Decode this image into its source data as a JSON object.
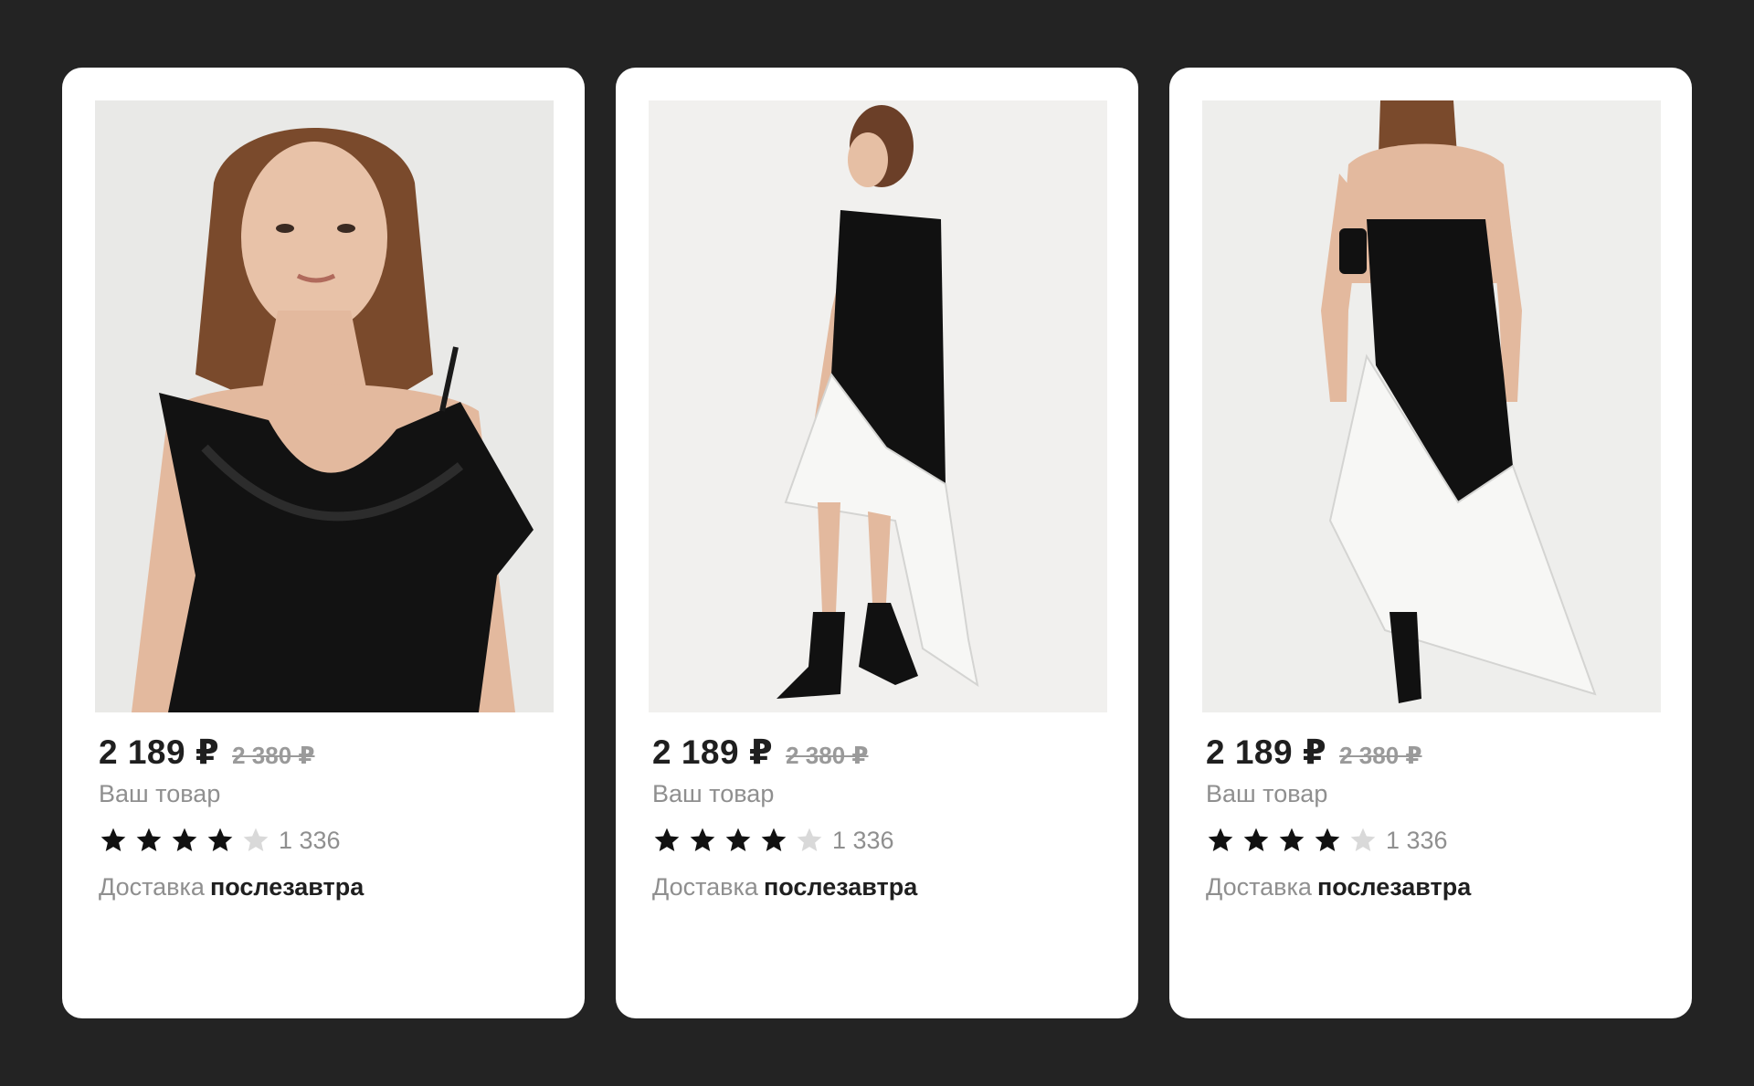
{
  "products": [
    {
      "price": "2 189 ₽",
      "old_price": "2 380 ₽",
      "title": "Ваш товар",
      "rating": 4,
      "rating_max": 5,
      "reviews": "1 336",
      "delivery_label": "Доставка",
      "delivery_value": "послезавтра",
      "image": "model-black-dress-front-closeup"
    },
    {
      "price": "2 189 ₽",
      "old_price": "2 380 ₽",
      "title": "Ваш товар",
      "rating": 4,
      "rating_max": 5,
      "reviews": "1 336",
      "delivery_label": "Доставка",
      "delivery_value": "послезавтра",
      "image": "model-black-white-dress-side"
    },
    {
      "price": "2 189 ₽",
      "old_price": "2 380 ₽",
      "title": "Ваш товар",
      "rating": 4,
      "rating_max": 5,
      "reviews": "1 336",
      "delivery_label": "Доставка",
      "delivery_value": "послезавтра",
      "image": "model-black-white-dress-back"
    }
  ],
  "colors": {
    "background": "#232323",
    "card": "#ffffff",
    "star_filled": "#111111",
    "star_empty": "#d9d9d9",
    "muted_text": "#8f8f8f"
  }
}
